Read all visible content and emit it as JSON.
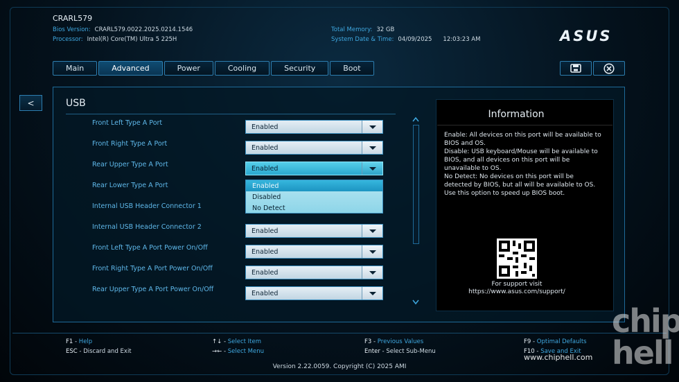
{
  "header": {
    "model": "CRARL579",
    "bios_version_label": "Bios Version:",
    "bios_version": "CRARL579.0022.2025.0214.1546",
    "processor_label": "Processor:",
    "processor": "Intel(R) Core(TM) Ultra 5 225H",
    "memory_label": "Total Memory:",
    "memory": "32 GB",
    "datetime_label": "System Date & Time:",
    "date": "04/09/2025",
    "time": "12:03:23 AM",
    "brand": "ASUS"
  },
  "tabs": [
    {
      "label": "Main",
      "active": false
    },
    {
      "label": "Advanced",
      "active": true
    },
    {
      "label": "Power",
      "active": false
    },
    {
      "label": "Cooling",
      "active": false
    },
    {
      "label": "Security",
      "active": false
    },
    {
      "label": "Boot",
      "active": false
    }
  ],
  "toolbar": {
    "save_icon": "save-icon",
    "exit_icon": "close-icon"
  },
  "back_label": "<",
  "section": {
    "title": "USB"
  },
  "settings": [
    {
      "label": "Front Left Type A Port",
      "value": "Enabled"
    },
    {
      "label": "Front Right Type A Port",
      "value": "Enabled"
    },
    {
      "label": "Rear Upper Type A Port",
      "value": "Enabled"
    },
    {
      "label": "Rear Lower Type A Port",
      "value": ""
    },
    {
      "label": "Internal USB Header Connector 1",
      "value": ""
    },
    {
      "label": "Internal USB Header Connector 2",
      "value": "Enabled"
    },
    {
      "label": "Front Left Type A Port Power On/Off",
      "value": "Enabled"
    },
    {
      "label": "Front Right Type A Port Power On/Off",
      "value": "Enabled"
    },
    {
      "label": "Rear Upper Type A Port Power On/Off",
      "value": "Enabled"
    }
  ],
  "dropdown_options": [
    "Enabled",
    "Disabled",
    "No Detect"
  ],
  "info": {
    "title": "Information",
    "lines": [
      "Enable: All devices on this port will be available to",
      "BIOS and OS.",
      "Disable: USB keyboard/Mouse will be available to",
      "BIOS, and all devices on this port will be",
      "unavailable to OS.",
      "No Detect: No devices on this port will be",
      "detected by BIOS, but all will be available to OS.",
      "Use this option to speed up BIOS boot."
    ],
    "support_text": "For support visit",
    "support_url": "https://www.asus.com/support/"
  },
  "footer": {
    "f1_key": "F1",
    "f1_action": "Help",
    "esc_key": "ESC",
    "esc_action": "Discard and Exit",
    "nav_key": "↑↓",
    "nav_action": "Select Item",
    "menu_key": "→←",
    "menu_action": "Select Menu",
    "f3_key": "F3",
    "f3_action": "Previous Values",
    "enter_key": "Enter",
    "enter_action": "Select Sub-Menu",
    "f9_key": "F9",
    "f9_action": "Optimal Defaults",
    "f10_key": "F10",
    "f10_action": "Save and Exit",
    "version": "Version 2.22.0059. Copyright (C) 2025 AMI"
  },
  "watermark": {
    "url": "www.chiphell.com",
    "logo": "chip hell"
  }
}
